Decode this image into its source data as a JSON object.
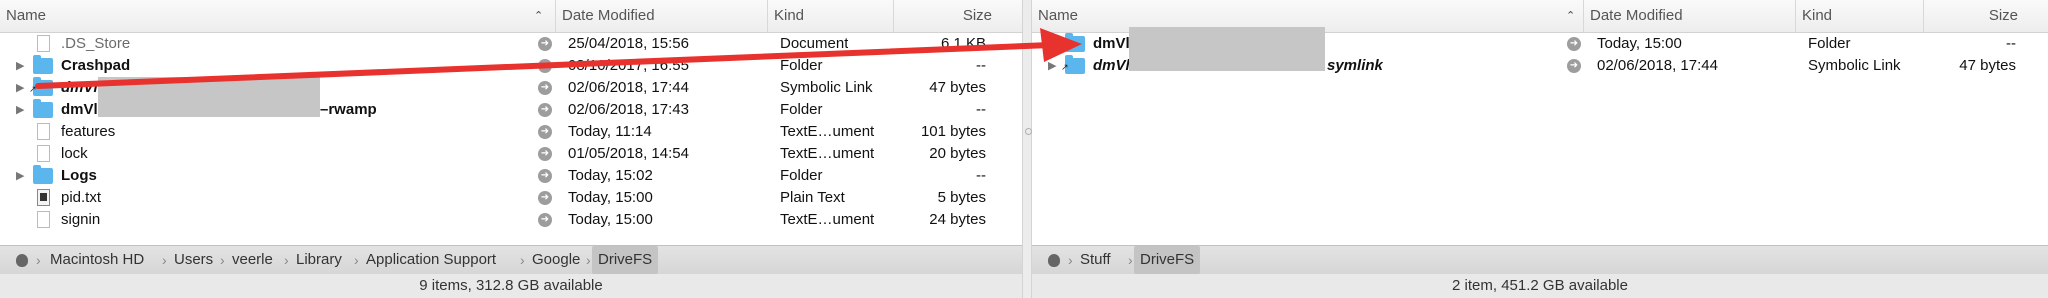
{
  "columns": {
    "name": "Name",
    "date_modified": "Date Modified",
    "kind": "Kind",
    "size": "Size"
  },
  "left_pane": {
    "rows": [
      {
        "name": ".DS_Store",
        "date": "25/04/2018, 15:56",
        "kind": "Document",
        "size": "6.1 KB",
        "icon": "document-icon"
      },
      {
        "name": "Crashpad",
        "date": "08/10/2017, 16:55",
        "kind": "Folder",
        "size": "--",
        "icon": "folder-icon"
      },
      {
        "name": "dmVl",
        "date": "02/06/2018, 17:44",
        "kind": "Symbolic Link",
        "size": "47 bytes",
        "icon": "folder-alias-icon"
      },
      {
        "name": "dmVl",
        "name_suffix": "–rwamp",
        "date": "02/06/2018, 17:43",
        "kind": "Folder",
        "size": "--",
        "icon": "folder-icon"
      },
      {
        "name": "features",
        "date": "Today, 11:14",
        "kind": "TextE…ument",
        "size": "101 bytes",
        "icon": "document-icon"
      },
      {
        "name": "lock",
        "date": "01/05/2018, 14:54",
        "kind": "TextE…ument",
        "size": "20 bytes",
        "icon": "document-icon"
      },
      {
        "name": "Logs",
        "date": "Today, 15:02",
        "kind": "Folder",
        "size": "--",
        "icon": "folder-icon"
      },
      {
        "name": "pid.txt",
        "date": "Today, 15:00",
        "kind": "Plain Text",
        "size": "5 bytes",
        "icon": "text-file-icon"
      },
      {
        "name": "signin",
        "date": "Today, 15:00",
        "kind": "TextE…ument",
        "size": "24 bytes",
        "icon": "document-icon"
      }
    ],
    "path": [
      "Macintosh HD",
      "Users",
      "veerle",
      "Library",
      "Application Support",
      "Google",
      "DriveFS"
    ],
    "status": "9 items, 312.8 GB available"
  },
  "right_pane": {
    "rows": [
      {
        "name": "dmVl",
        "date": "Today, 15:00",
        "kind": "Folder",
        "size": "--",
        "icon": "folder-icon"
      },
      {
        "name": "dmVl",
        "name_suffix": "symlink",
        "date": "02/06/2018, 17:44",
        "kind": "Symbolic Link",
        "size": "47 bytes",
        "icon": "folder-alias-icon"
      }
    ],
    "path": [
      "Stuff",
      "DriveFS"
    ],
    "status": "2 item, 451.2 GB available"
  },
  "colors": {
    "folder": "#5cb6ee",
    "annotation_arrow": "#e8322e",
    "redaction": "#c6c6c6"
  }
}
